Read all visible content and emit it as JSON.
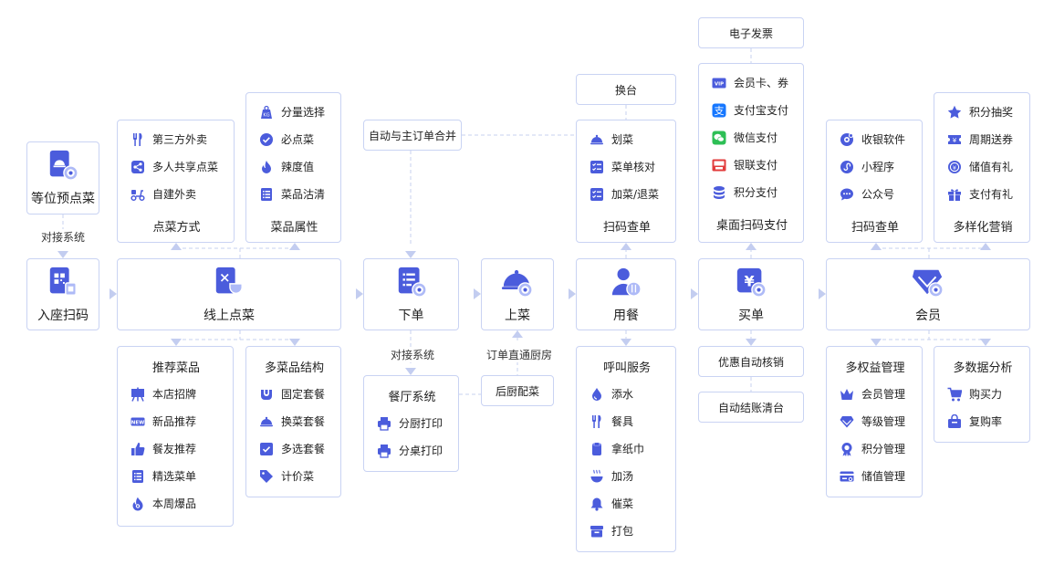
{
  "colors": {
    "accent": "#4b5cdc",
    "border": "#c9d3f3",
    "line": "#c7d0ef",
    "wechat": "#2dbf55",
    "alipay": "#1677ff",
    "unionpay": "#e23c3c"
  },
  "flow": {
    "reserve": "等位预点菜",
    "seat_scan": "入座扫码",
    "online_order": "线上点菜",
    "place_order": "下单",
    "serve": "上菜",
    "dining": "用餐",
    "checkout": "买单",
    "member": "会员"
  },
  "tags": {
    "connect1": "对接系统",
    "connect2": "对接系统",
    "direct_kitchen": "订单直通厨房"
  },
  "groups": {
    "order_mode": {
      "title": "点菜方式",
      "items": [
        {
          "icon": "fork-knife-icon",
          "label": "第三方外卖"
        },
        {
          "icon": "share-icon",
          "label": "多人共享点菜"
        },
        {
          "icon": "scooter-icon",
          "label": "自建外卖"
        }
      ]
    },
    "dish_attr": {
      "title": "菜品属性",
      "items": [
        {
          "icon": "weight-icon",
          "label": "分量选择"
        },
        {
          "icon": "check-circle-icon",
          "label": "必点菜"
        },
        {
          "icon": "flame-icon",
          "label": "辣度值"
        },
        {
          "icon": "list-icon",
          "label": "菜品沽清"
        }
      ]
    },
    "recommend": {
      "title": "推荐菜品",
      "items": [
        {
          "icon": "signboard-icon",
          "label": "本店招牌"
        },
        {
          "icon": "new-badge-icon",
          "label": "新品推荐"
        },
        {
          "icon": "thumbs-up-icon",
          "label": "餐友推荐"
        },
        {
          "icon": "list-icon",
          "label": "精选菜单"
        },
        {
          "icon": "hot-icon",
          "label": "本周爆品"
        }
      ]
    },
    "structure": {
      "title": "多菜品结构",
      "items": [
        {
          "icon": "bowl-icon",
          "label": "固定套餐"
        },
        {
          "icon": "cloche-icon",
          "label": "换菜套餐"
        },
        {
          "icon": "checkbox-icon",
          "label": "多选套餐"
        },
        {
          "icon": "price-tag-icon",
          "label": "计价菜"
        }
      ]
    },
    "restaurant_sys": {
      "title": "餐厅系统",
      "items": [
        {
          "icon": "printer-icon",
          "label": "分厨打印"
        },
        {
          "icon": "printer-icon",
          "label": "分桌打印"
        }
      ]
    },
    "scan_check1": {
      "title": "扫码查单",
      "items": [
        {
          "icon": "cloche-icon",
          "label": "划菜"
        },
        {
          "icon": "checklist-icon",
          "label": "菜单核对"
        },
        {
          "icon": "checklist-icon",
          "label": "加菜/退菜"
        }
      ]
    },
    "call_service": {
      "title": "呼叫服务",
      "items": [
        {
          "icon": "drop-icon",
          "label": "添水"
        },
        {
          "icon": "fork-knife-icon",
          "label": "餐具"
        },
        {
          "icon": "tissue-icon",
          "label": "拿纸巾"
        },
        {
          "icon": "soup-icon",
          "label": "加汤"
        },
        {
          "icon": "bell-icon",
          "label": "催菜"
        },
        {
          "icon": "box-icon",
          "label": "打包"
        }
      ]
    },
    "table_pay": {
      "title": "桌面扫码支付",
      "items": [
        {
          "icon": "vip-card-icon",
          "label": "会员卡、券"
        },
        {
          "icon": "alipay-icon",
          "label": "支付宝支付"
        },
        {
          "icon": "wechat-icon",
          "label": "微信支付"
        },
        {
          "icon": "unionpay-icon",
          "label": "银联支付"
        },
        {
          "icon": "coins-icon",
          "label": "积分支付"
        }
      ]
    },
    "scan_check2": {
      "title": "扫码查单",
      "items": [
        {
          "icon": "cash-register-icon",
          "label": "收银软件"
        },
        {
          "icon": "mini-program-icon",
          "label": "小程序"
        },
        {
          "icon": "chat-icon",
          "label": "公众号"
        }
      ]
    },
    "marketing": {
      "title": "多样化营销",
      "items": [
        {
          "icon": "star-icon",
          "label": "积分抽奖"
        },
        {
          "icon": "ticket-icon",
          "label": "周期送券"
        },
        {
          "icon": "coin-icon",
          "label": "储值有礼"
        },
        {
          "icon": "gift-icon",
          "label": "支付有礼"
        }
      ]
    },
    "rights": {
      "title": "多权益管理",
      "items": [
        {
          "icon": "crown-icon",
          "label": "会员管理"
        },
        {
          "icon": "diamond-icon",
          "label": "等级管理"
        },
        {
          "icon": "medal-icon",
          "label": "积分管理"
        },
        {
          "icon": "card-icon",
          "label": "储值管理"
        }
      ]
    },
    "analysis": {
      "title": "多数据分析",
      "items": [
        {
          "icon": "cart-icon",
          "label": "购买力"
        },
        {
          "icon": "bag-icon",
          "label": "复购率"
        }
      ]
    }
  },
  "singles": {
    "merge": "自动与主订单合并",
    "kitchen_dish": "后厨配菜",
    "change_table": "换台",
    "e_invoice": "电子发票",
    "auto_discount": "优惠自动核销",
    "auto_settle": "自动结账清台"
  }
}
